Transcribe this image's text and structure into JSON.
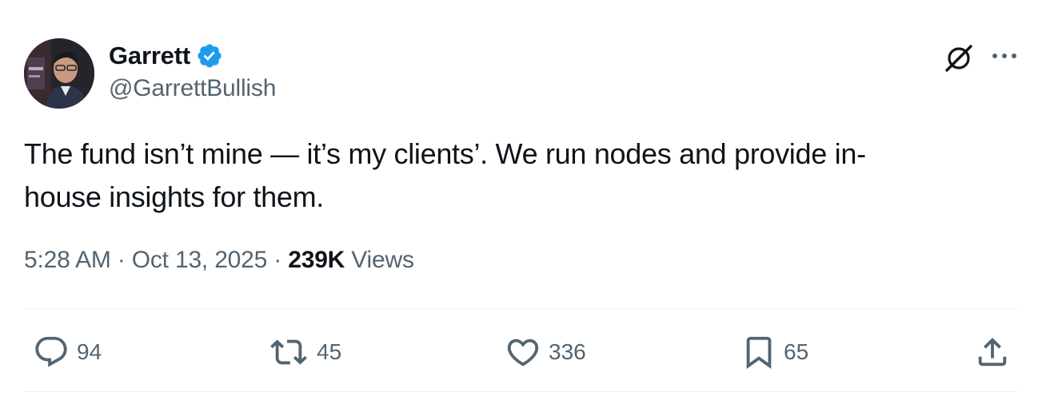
{
  "author": {
    "name": "Garrett",
    "handle": "@GarrettBullish",
    "verified": true,
    "verified_color": "#1d9bf0"
  },
  "tweet": {
    "text": "The fund isn’t mine — it’s my clients’. We run nodes and provide in-\nhouse insights for them."
  },
  "meta": {
    "time": "5:28 AM",
    "separator": "·",
    "date": "Oct 13, 2025",
    "views_count": "239K",
    "views_label": "Views"
  },
  "actions": {
    "replies": "94",
    "reposts": "45",
    "likes": "336",
    "bookmarks": "65"
  },
  "icons": {
    "header": [
      "grok-icon",
      "more-icon"
    ],
    "actions": [
      "reply-icon",
      "retweet-icon",
      "like-icon",
      "bookmark-icon",
      "share-icon"
    ]
  },
  "colors": {
    "text": "#0f1419",
    "secondary": "#536471",
    "divider": "#eff3f4"
  }
}
